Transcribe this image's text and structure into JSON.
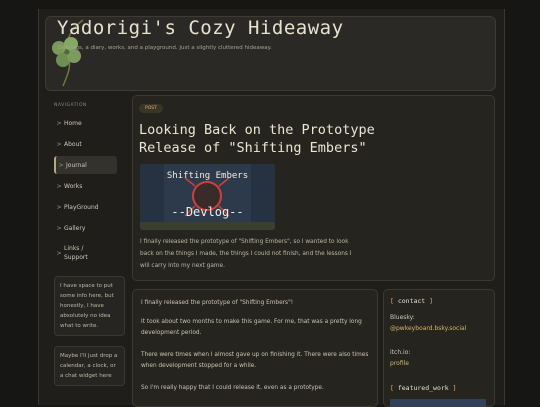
{
  "header": {
    "title": "Yadorigi's Cozy Hideaway",
    "subtitle": "Dev logs, a diary, works, and a playground. Just a slightly cluttered hideaway."
  },
  "sidebar": {
    "heading": "NAVIGATION",
    "items": [
      {
        "label": "Home"
      },
      {
        "label": "About"
      },
      {
        "label": "Journal",
        "active": true
      },
      {
        "label": "Works"
      },
      {
        "label": "PlayGround"
      },
      {
        "label": "Gallery"
      },
      {
        "label": "Links /\nSupport"
      }
    ],
    "note1": "I have space to put some info here, but honestly, I have absolutely no idea what to write.",
    "note2": "Maybe I'll just drop a calendar, a clock, or a chat widget here"
  },
  "post": {
    "tag": "POST",
    "title": "Looking Back on the Prototype Release of \"Shifting Embers\"",
    "thumb_title": "Shifting Embers",
    "thumb_sub": "--Devlog--",
    "excerpt": "I finally released the prototype of \"Shifting Embers\", so I wanted to look back on the things I made, the things I could not finish, and the lessons I will carry into my next game."
  },
  "article": {
    "p1": "I finally released the prototype of \"Shifting Embers\"!",
    "p2": "It took about two months to make this game. For me, that was a pretty long development period.",
    "p3": "There were times when I almost gave up on finishing it. There were also times when development stopped for a while.",
    "p4": "So I'm really happy that I could release it, even as a prototype."
  },
  "contact": {
    "heading": "contact",
    "bluesky_label": "Bluesky:",
    "bluesky_link": "@pwkeyboard.bsky.social",
    "itchio_label": "itch.io:",
    "itchio_link": "profile",
    "featured_heading": "featured_work"
  },
  "colors": {
    "accent": "#d8b66e",
    "background": "#161614",
    "panel": "#25241f"
  }
}
